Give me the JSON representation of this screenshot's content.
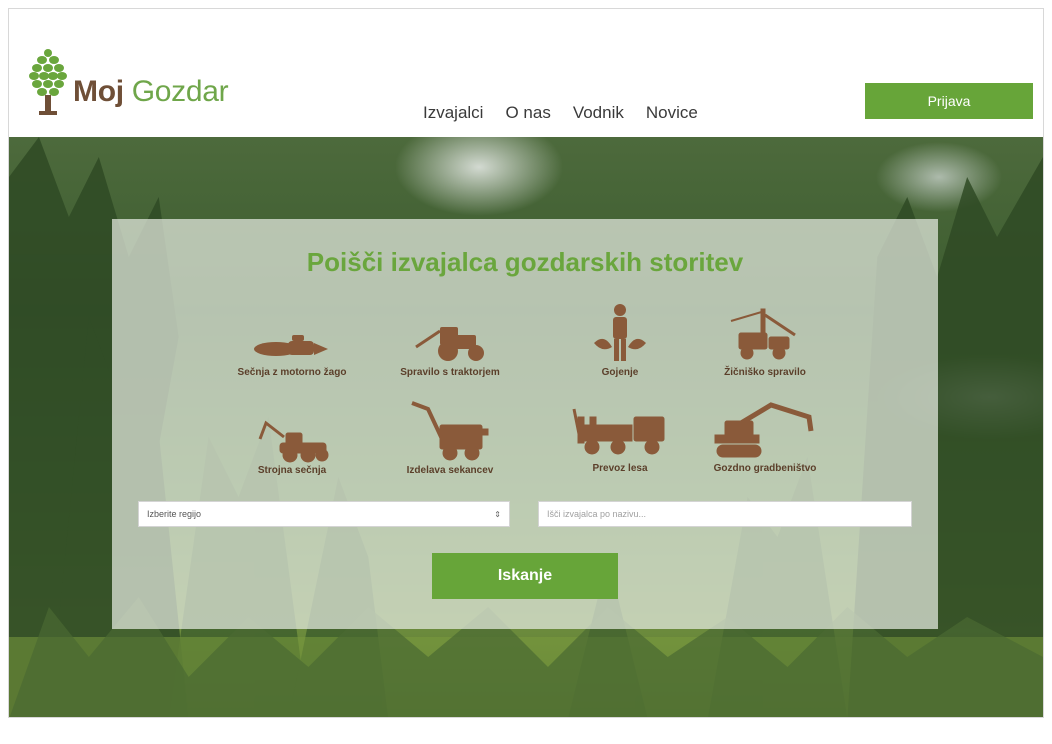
{
  "brand": {
    "name_part1": "Moj",
    "name_part2": "Gozdar"
  },
  "nav": {
    "items": [
      "Izvajalci",
      "O nas",
      "Vodnik",
      "Novice"
    ]
  },
  "header": {
    "login_label": "Prijava"
  },
  "search": {
    "title": "Poišči izvajalca gozdarskih storitev",
    "services": [
      {
        "label": "Sečnja z motorno žago",
        "icon": "chainsaw-icon"
      },
      {
        "label": "Spravilo s traktorjem",
        "icon": "tractor-icon"
      },
      {
        "label": "Gojenje",
        "icon": "forester-icon"
      },
      {
        "label": "Žičniško spravilo",
        "icon": "cable-crane-icon"
      },
      {
        "label": "Strojna sečnja",
        "icon": "harvester-icon"
      },
      {
        "label": "Izdelava sekancev",
        "icon": "chipper-icon"
      },
      {
        "label": "Prevoz lesa",
        "icon": "timber-truck-icon"
      },
      {
        "label": "Gozdno gradbeništvo",
        "icon": "excavator-icon"
      }
    ],
    "region_select_value": "Izberite regijo",
    "name_placeholder": "Išči izvajalca po nazivu...",
    "submit_label": "Iskanje"
  },
  "colors": {
    "accent": "#67a539",
    "brown": "#6f4f37",
    "icon_brown": "#8a5a3a"
  }
}
